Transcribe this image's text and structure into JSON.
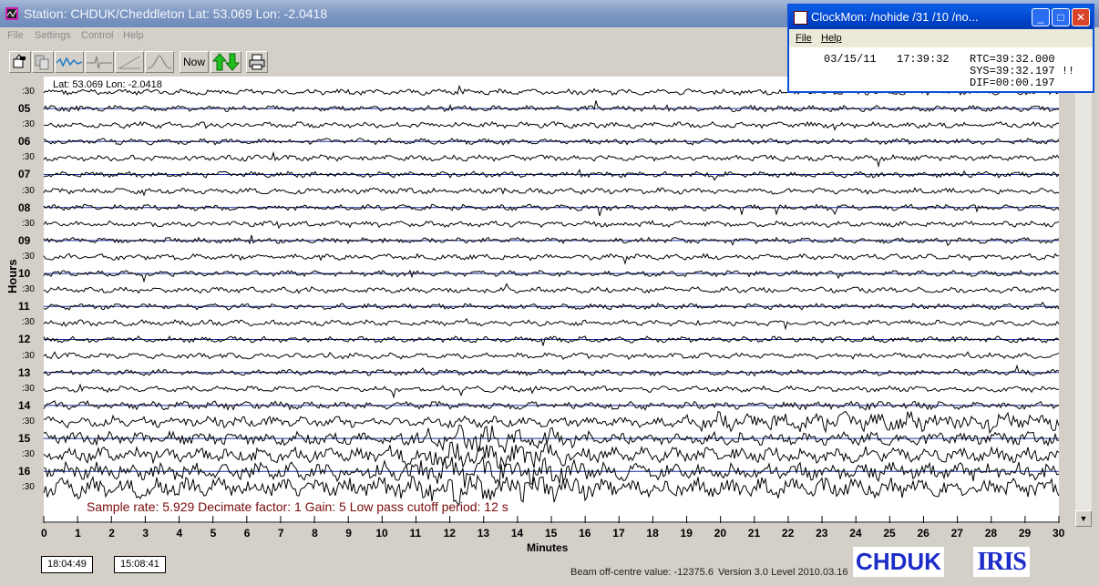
{
  "window": {
    "title": "Station: CHDUK/Cheddleton Lat: 53.069 Lon: -2.0418"
  },
  "menu": [
    "File",
    "Settings",
    "Control",
    "Help"
  ],
  "toolbar": {
    "now_label": "Now"
  },
  "plot": {
    "lat_lon_label": "Lat: 53.069 Lon: -2.0418",
    "hours_title": "Hours",
    "minutes_title": "Minutes",
    "hour_labels": [
      "05",
      "06",
      "07",
      "08",
      "09",
      "10",
      "11",
      "12",
      "13",
      "14",
      "15",
      "16"
    ],
    "half_label": ":30",
    "minute_ticks": [
      "0",
      "1",
      "2",
      "3",
      "4",
      "5",
      "6",
      "7",
      "8",
      "9",
      "10",
      "11",
      "12",
      "13",
      "14",
      "15",
      "16",
      "17",
      "18",
      "19",
      "20",
      "21",
      "22",
      "23",
      "24",
      "25",
      "26",
      "27",
      "28",
      "29",
      "30"
    ],
    "sample_info": "Sample rate: 5.929  Decimate factor: 1  Gain: 5  Low pass cutoff period: 12 s"
  },
  "timeboxes": [
    "18:04:49",
    "15:08:41"
  ],
  "status": {
    "beam": "Beam off-centre value: -12375.6",
    "version": "Version 3.0 Level 2010.03.16"
  },
  "logos": {
    "station": "CHDUK",
    "network": "IRIS"
  },
  "clockmon": {
    "title": "ClockMon:  /nohide  /31  /10  /no...",
    "menu": [
      "File",
      "Help"
    ],
    "date": "03/15/11",
    "time": "17:39:32",
    "rtc": "RTC=39:32.000",
    "sys": "SYS=39:32.197 !!",
    "dif": "DIF=00:00.197"
  },
  "colors": {
    "title_bar_inactive": "#7d97c2",
    "clockmon_title": "#0044cc",
    "sample_info": "#7a0b0b",
    "logo_text": "#1c2cc8",
    "grid_line": "#1a2a9a"
  }
}
